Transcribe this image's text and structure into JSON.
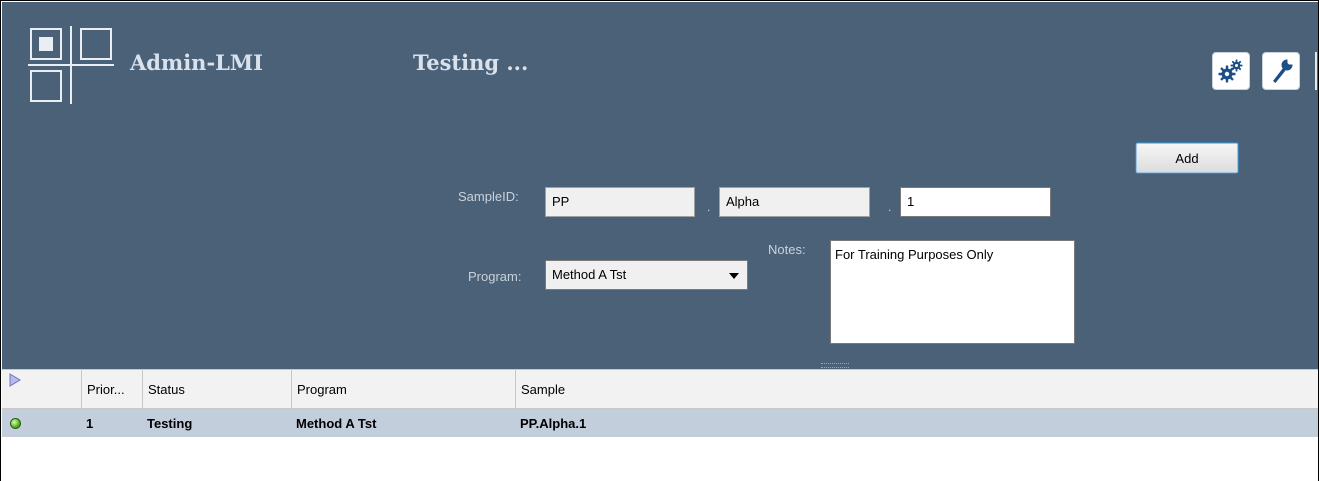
{
  "header": {
    "app_title": "Admin-LMI",
    "page_title": "Testing ...",
    "background_color": "#4b6178",
    "settings_icon": "gears-icon",
    "tools_icon": "wrench-icon",
    "logo_icon": "grid-logo-icon"
  },
  "form": {
    "add_label": "Add",
    "sample_id_label": "SampleID:",
    "sample_id_part1": "PP",
    "sample_id_part2": "Alpha",
    "sample_id_part3": "1",
    "separator": ".",
    "program_label": "Program:",
    "program_selected": "Method A Tst",
    "notes_label": "Notes:",
    "notes_value": "For Training Purposes Only"
  },
  "grid": {
    "row_selected_color": "#c2cedb",
    "columns": [
      "Prior...",
      "Status",
      "Program",
      "Sample"
    ],
    "rows": [
      {
        "status_icon": "green-status-dot-icon",
        "priority": "1",
        "status": "Testing",
        "program": "Method A Tst",
        "sample": "PP.Alpha.1"
      }
    ]
  }
}
